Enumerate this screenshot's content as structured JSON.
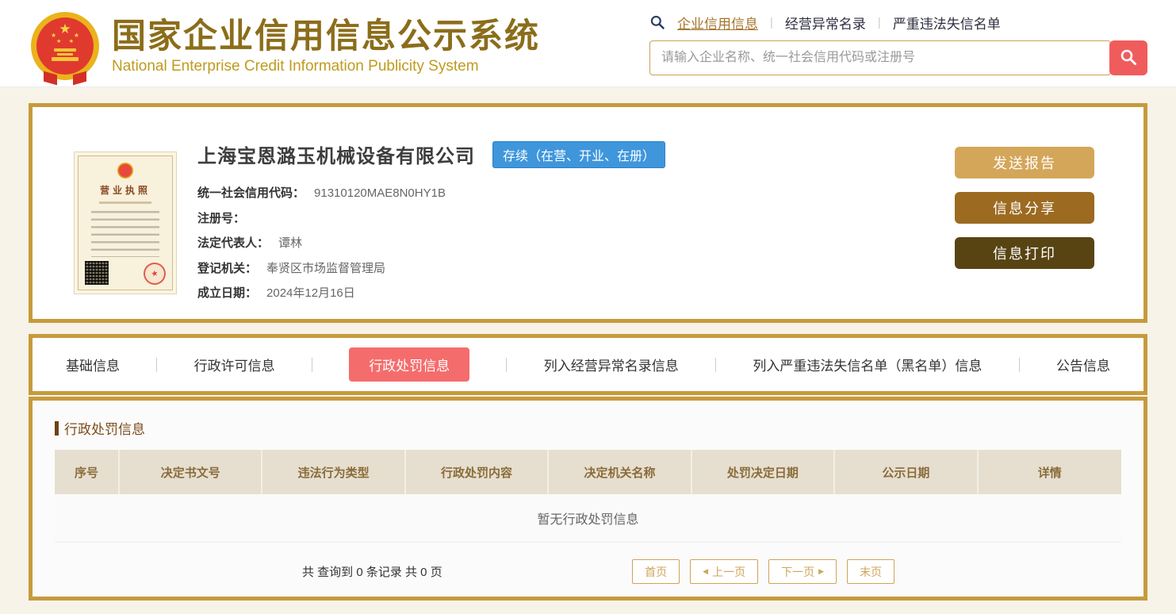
{
  "header": {
    "site_title_zh": "国家企业信用信息公示系统",
    "site_title_en": "National Enterprise Credit Information Publicity System",
    "nav": [
      {
        "label": "企业信用信息",
        "active": true
      },
      {
        "label": "经营异常名录",
        "active": false
      },
      {
        "label": "严重违法失信名单",
        "active": false
      }
    ],
    "search": {
      "placeholder": "请输入企业名称、统一社会信用代码或注册号"
    }
  },
  "company": {
    "name": "上海宝恩潞玉机械设备有限公司",
    "status_badge": "存续（在营、开业、在册）",
    "license_title": "营业执照",
    "fields": [
      {
        "label": "统一社会信用代码：",
        "value": "91310120MAE8N0HY1B"
      },
      {
        "label": "注册号：",
        "value": ""
      },
      {
        "label": "法定代表人：",
        "value": "谭林"
      },
      {
        "label": "登记机关：",
        "value": "奉贤区市场监督管理局"
      },
      {
        "label": "成立日期：",
        "value": "2024年12月16日"
      }
    ],
    "actions": [
      {
        "label": "发送报告"
      },
      {
        "label": "信息分享"
      },
      {
        "label": "信息打印"
      }
    ]
  },
  "tabs": [
    {
      "label": "基础信息",
      "active": false
    },
    {
      "label": "行政许可信息",
      "active": false
    },
    {
      "label": "行政处罚信息",
      "active": true
    },
    {
      "label": "列入经营异常名录信息",
      "active": false
    },
    {
      "label": "列入严重违法失信名单（黑名单）信息",
      "active": false
    },
    {
      "label": "公告信息",
      "active": false
    }
  ],
  "panel": {
    "section_title": "行政处罚信息",
    "table": {
      "columns": [
        "序号",
        "决定书文号",
        "违法行为类型",
        "行政处罚内容",
        "决定机关名称",
        "处罚决定日期",
        "公示日期",
        "详情"
      ],
      "empty_text": "暂无行政处罚信息"
    },
    "pagination": {
      "summary": "共 查询到 0 条记录 共 0 页",
      "first": "首页",
      "prev": "上一页",
      "next": "下一页",
      "last": "末页",
      "prev_icon": "◀",
      "next_icon": "▶"
    }
  },
  "colors": {
    "gold_border": "#c69b3d",
    "brand_title": "#8b6d1a",
    "brand_subtitle": "#bf9b1e",
    "status_blue": "#3f96db",
    "active_tab_red": "#f56c6c",
    "search_button_red": "#f05c5c",
    "button_send": "#d4a659",
    "button_share": "#9c6a20",
    "button_print": "#584413",
    "table_header_bg": "#e6dfd0",
    "pagination_gold": "#cda558"
  }
}
